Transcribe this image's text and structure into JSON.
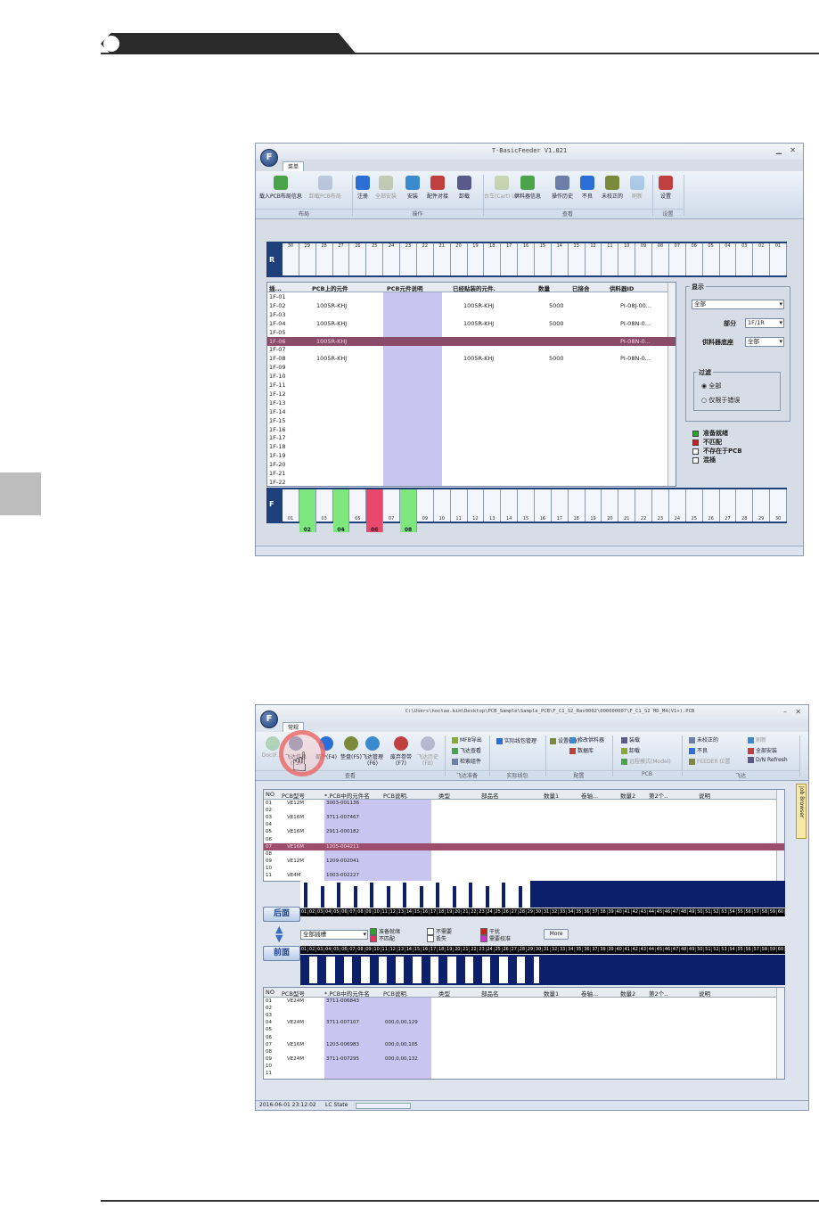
{
  "window1": {
    "title": "T-BasicFeeder V1.021",
    "app_button": "F",
    "tab_label": "菜单",
    "ribbon": {
      "buttons": [
        {
          "label": "载入PCB布局信息",
          "disabled": false
        },
        {
          "label": "卸载PCB布局",
          "disabled": true
        },
        {
          "label": "注册",
          "disabled": false
        },
        {
          "label": "全部安装",
          "disabled": true
        },
        {
          "label": "安装",
          "disabled": false
        },
        {
          "label": "配件对接",
          "disabled": false
        },
        {
          "label": "卸载",
          "disabled": false
        },
        {
          "label": "台车(Cart) UP",
          "disabled": true
        },
        {
          "label": "供料器信息",
          "disabled": false
        },
        {
          "label": "操作历史",
          "disabled": false
        },
        {
          "label": "不良",
          "disabled": false
        },
        {
          "label": "未校正的",
          "disabled": false
        },
        {
          "label": "刷新",
          "disabled": true
        },
        {
          "label": "设置",
          "disabled": false
        }
      ],
      "groups": [
        "布局",
        "操作",
        "查看",
        "设置"
      ]
    },
    "r_strip": {
      "label": "R",
      "slots": [
        "30",
        "29",
        "28",
        "27",
        "26",
        "25",
        "24",
        "23",
        "22",
        "21",
        "20",
        "19",
        "18",
        "17",
        "16",
        "15",
        "14",
        "13",
        "12",
        "11",
        "10",
        "09",
        "08",
        "07",
        "06",
        "05",
        "04",
        "03",
        "02",
        "01"
      ]
    },
    "table": {
      "columns": [
        "插...",
        "PCB上的元件",
        "PCB元件说明",
        "已经贴装的元件.",
        "数量",
        "已接合",
        "供料器ID"
      ],
      "rows": [
        {
          "slot": "1F-01",
          "part": "",
          "qty": "",
          "feeder": "",
          "placed": ""
        },
        {
          "slot": "1F-02",
          "part": "1005R-KHJ",
          "placed": "1005R-KHJ",
          "qty": "5000",
          "feeder": "PI-08J-00..."
        },
        {
          "slot": "1F-03",
          "part": "",
          "qty": "",
          "feeder": "",
          "placed": ""
        },
        {
          "slot": "1F-04",
          "part": "1005R-KHJ",
          "placed": "1005R-KHJ",
          "qty": "5000",
          "feeder": "PI-08N-0..."
        },
        {
          "slot": "1F-05",
          "part": "",
          "qty": "",
          "feeder": "",
          "placed": ""
        },
        {
          "slot": "1F-06",
          "part": "1005R-KHJ",
          "placed": "",
          "qty": "",
          "feeder": "PI-08N-0..."
        },
        {
          "slot": "1F-07",
          "part": "",
          "qty": "",
          "feeder": "",
          "placed": ""
        },
        {
          "slot": "1F-08",
          "part": "1005R-KHJ",
          "placed": "1005R-KHJ",
          "qty": "5000",
          "feeder": "PI-08N-0..."
        },
        {
          "slot": "1F-09"
        },
        {
          "slot": "1F-10"
        },
        {
          "slot": "1F-11"
        },
        {
          "slot": "1F-12"
        },
        {
          "slot": "1F-13"
        },
        {
          "slot": "1F-14"
        },
        {
          "slot": "1F-15"
        },
        {
          "slot": "1F-16"
        },
        {
          "slot": "1F-17"
        },
        {
          "slot": "1F-18"
        },
        {
          "slot": "1F-19"
        },
        {
          "slot": "1F-20"
        },
        {
          "slot": "1F-21"
        },
        {
          "slot": "1F-22"
        }
      ],
      "selected_index": 5
    },
    "display_panel": {
      "title": "显示",
      "all_option": "全部",
      "part_label": "部分",
      "part_value": "1F/1R",
      "feeder_base_label": "供料器底座",
      "feeder_base_value": "全部",
      "filter_title": "过滤",
      "filter_all": "全部",
      "filter_error_only": "仅限于错误",
      "legend": [
        {
          "label": "准备就绪",
          "color": "#2fa12f"
        },
        {
          "label": "不匹配",
          "color": "#c81f1f"
        },
        {
          "label": "不存在于PCB",
          "color": "#ffffff"
        },
        {
          "label": "混插",
          "color": "#ffffff"
        }
      ]
    },
    "f_strip": {
      "label": "F",
      "slots": [
        "01",
        "02",
        "03",
        "04",
        "05",
        "06",
        "07",
        "08",
        "09",
        "10",
        "11",
        "12",
        "13",
        "14",
        "15",
        "16",
        "17",
        "18",
        "19",
        "20",
        "21",
        "22",
        "23",
        "24",
        "25",
        "26",
        "27",
        "28",
        "29",
        "30"
      ],
      "highlighted": [
        {
          "slot": "02",
          "color": "#7ee87e"
        },
        {
          "slot": "04",
          "color": "#7ee87e"
        },
        {
          "slot": "06",
          "color": "#e8496a"
        },
        {
          "slot": "08",
          "color": "#7ee87e"
        }
      ]
    }
  },
  "window2": {
    "title": "C:\\Users\\hoctae.kim\\Desktop\\PCB_Sample\\Sample_PCB\\F_C1_S2_Rev0002\\000000007\\F_C1_S2 HD_M4(V1+).PCB",
    "app_button": "F",
    "tab_label": "常规",
    "ribbon": {
      "buttons": [
        {
          "label": "Doc(F...)",
          "disabled": true
        },
        {
          "label": "飞达信息(F3)",
          "disabled": false
        },
        {
          "label": "部件(F4)",
          "disabled": false
        },
        {
          "label": "垫盘(F5)",
          "disabled": false
        },
        {
          "label": "飞达管理(F6)",
          "disabled": false
        },
        {
          "label": "废弃卷带(F7)",
          "disabled": false
        },
        {
          "label": "飞达历史(F8)",
          "disabled": true
        },
        {
          "label": "MFB导出",
          "disabled": false
        },
        {
          "label": "飞达查看",
          "disabled": false
        },
        {
          "label": "检索组件",
          "disabled": false
        },
        {
          "label": "实际线包管理",
          "disabled": false
        },
        {
          "label": "设置(F9)",
          "disabled": false
        },
        {
          "label": "修改供料器",
          "disabled": false
        },
        {
          "label": "数据库",
          "disabled": false
        },
        {
          "label": "装载",
          "disabled": false
        },
        {
          "label": "卸载",
          "disabled": false
        },
        {
          "label": "远程模式(Model)",
          "disabled": true
        },
        {
          "label": "未校正的",
          "disabled": false
        },
        {
          "label": "不良",
          "disabled": false
        },
        {
          "label": "FEEDER 位置",
          "disabled": true
        },
        {
          "label": "刷新",
          "disabled": true
        },
        {
          "label": "全部安装",
          "disabled": false
        },
        {
          "label": "D/N Refresh",
          "disabled": false
        }
      ],
      "groups": [
        "查看",
        "飞达准备",
        "实际线包",
        "配置",
        "PCB",
        "飞达"
      ]
    },
    "side_panel_label": "Job Browser",
    "top_table": {
      "columns": [
        "NO",
        "PCB型号",
        "*.PCB中的元件名",
        "PCB说明.",
        "类型",
        "部品名",
        "数量1",
        "卷轴...",
        "数量2",
        "第2个..",
        "说明"
      ],
      "rows": [
        {
          "no": "01",
          "model": "VE12M",
          "part": "3003-001136"
        },
        {
          "no": "02"
        },
        {
          "no": "03",
          "model": "VE16M",
          "part": "3711-007467"
        },
        {
          "no": "04"
        },
        {
          "no": "05",
          "model": "VE16M",
          "part": "2911-000182"
        },
        {
          "no": "06"
        },
        {
          "no": "07",
          "model": "VE16M",
          "part": "1205-004211"
        },
        {
          "no": "08"
        },
        {
          "no": "09",
          "model": "VE12M",
          "part": "1209-002041"
        },
        {
          "no": "10"
        },
        {
          "no": "11",
          "model": "VE4M",
          "part": "1003-002227"
        }
      ],
      "selected_index": 6
    },
    "rear_button": "后面",
    "front_button": "前面",
    "slot_combo": "全部插槽",
    "legend": [
      {
        "label": "准备就绪",
        "color": "#2fa12f"
      },
      {
        "label": "不匹配",
        "color": "#e0345e"
      },
      {
        "label": "不需要",
        "color": "#ffffff"
      },
      {
        "label": "丢失",
        "color": "#ffffff"
      },
      {
        "label": "干扰",
        "color": "#c81f1f"
      },
      {
        "label": "需要校准",
        "color": "#cc33cc"
      }
    ],
    "more_button": "More",
    "bottom_table": {
      "columns": [
        "NO",
        "PCB型号",
        "*.PCB中的元件名",
        "PCB说明.",
        "类型",
        "部品名",
        "数量1",
        "卷轴...",
        "数量2",
        "第2个..",
        "说明"
      ],
      "rows": [
        {
          "no": "01",
          "model": "VE24M",
          "part": "3711-006843",
          "desc": ""
        },
        {
          "no": "02"
        },
        {
          "no": "03"
        },
        {
          "no": "04",
          "model": "VE24M",
          "part": "3711-007107",
          "desc": "000,0,00,129"
        },
        {
          "no": "05"
        },
        {
          "no": "06"
        },
        {
          "no": "07",
          "model": "VE16M",
          "part": "1203-006983",
          "desc": "000,0,00,105"
        },
        {
          "no": "08"
        },
        {
          "no": "09",
          "model": "VE24M",
          "part": "3711-007295",
          "desc": "000,0,00,132"
        },
        {
          "no": "10"
        },
        {
          "no": "11"
        }
      ]
    },
    "status": {
      "timestamp": "2016-06-01 23:12:02",
      "state": "LC State"
    }
  }
}
